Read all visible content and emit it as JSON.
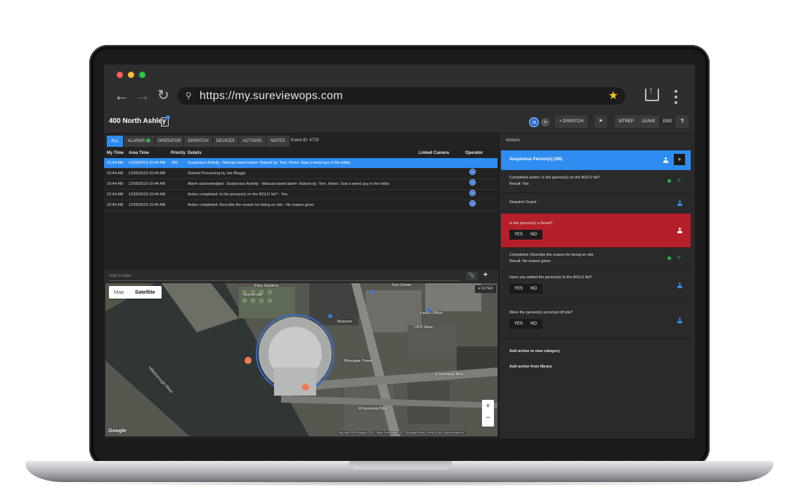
{
  "browser": {
    "url": "https://my.sureviewops.com"
  },
  "app": {
    "site_name": "400 North Ashley",
    "header": {
      "avatar_initials": "JB",
      "dispatch_label": "+ DISPATCH",
      "sitrep_label": "SITREP",
      "leave_label": "LEAVE",
      "end_label": "END",
      "help_label": "?"
    },
    "tabs": [
      {
        "label": "ALL",
        "active": true
      },
      {
        "label": "ALARMS",
        "badge": true
      },
      {
        "label": "OPERATOR"
      },
      {
        "label": "DISPATCH"
      },
      {
        "label": "DEVICES"
      },
      {
        "label": "ACTIONS"
      },
      {
        "label": "NOTES"
      }
    ],
    "event_id": "Event ID: 4725",
    "table": {
      "columns": [
        "My Time",
        "Area Time",
        "Priority",
        "Details",
        "Linked Camera",
        "Operator"
      ],
      "rows": [
        {
          "my_time": "10:44 AM",
          "area_time": "12/05/2019 10:44 AM",
          "priority": "250",
          "details": "Suspicious Activity - Manual raised alarm- Raised by: Tom, Notes: Saw a weird guy in the lobby",
          "selected": true
        },
        {
          "my_time": "10:44 AM",
          "area_time": "12/05/2019 10:44 AM",
          "priority": "",
          "details": "Started Processing by Joe Bloggs",
          "operator": "JB"
        },
        {
          "my_time": "10:44 AM",
          "area_time": "12/05/2019 10:44 AM",
          "priority": "",
          "details": "Alarm acknowledged : Suspicious Activity - Manual raised alarm- Raised by: Tom, Notes: Saw a weird guy in the lobby",
          "operator": "JB"
        },
        {
          "my_time": "10:44 AM",
          "area_time": "12/05/2019 10:44 AM",
          "priority": "",
          "details": "Action completed: Is the person(s) on the BOLO list? - Yes",
          "operator": "JB"
        },
        {
          "my_time": "10:45 AM",
          "area_time": "12/05/2019 10:45 AM",
          "priority": "",
          "details": "Action completed: Describe the reason for being on site - No reason given",
          "operator": "JB"
        }
      ]
    },
    "note": {
      "placeholder": "Add a note"
    },
    "map": {
      "toggle_map": "Map",
      "toggle_satellite": "Satellite",
      "filter_label": "▾ FILTER",
      "zoom_in": "+",
      "zoom_out": "−",
      "google_label": "Google",
      "attribution": "Map data ©2019 Imagery ©2019 , Maxar Technologies, U.S. Geological Survey | Terms of Use | Report a map error",
      "labels": {
        "kiley": "Kiley Gardens",
        "oxford": "Oxford HM",
        "river": "Hillsborough River",
        "kennedy": "E Kennedy Blvd",
        "w_kennedy": "W Kennedy Blvd",
        "fedex": "FedEx Office",
        "sun": "Sun Center",
        "ups": "UPS Store",
        "museum": "Museum",
        "tower": "Rivergate Tower"
      }
    },
    "actions_panel": {
      "title": "Actions",
      "category": "Suspicious Person(s) (3/6)",
      "items": [
        {
          "text": "Completed action: Is the person(s) on the BOLO list?",
          "sub": "Result: Yes",
          "completed": true
        },
        {
          "text": "Dispatch Guard"
        },
        {
          "text": "Is the person(s) a threat?",
          "yes": "YES",
          "no": "NO",
          "highlighted": true
        },
        {
          "text": "Completed: Describe the reason for being on site",
          "sub": "Result: No reason given",
          "completed": true
        },
        {
          "text": "Have you added the person(s) to the BOLO list?",
          "yes": "YES",
          "no": "NO"
        },
        {
          "text": "Were the person(s) escorted off site?",
          "yes": "YES",
          "no": "NO"
        }
      ],
      "add_category": "Add action to new category",
      "add_library": "Add action from library"
    }
  },
  "colors": {
    "accent": "#2f8cf0",
    "alert": "#b51f2a",
    "success": "#2eb34a",
    "star": "#f5c518"
  }
}
